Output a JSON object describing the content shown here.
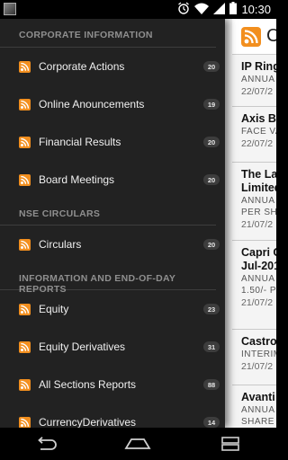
{
  "status_bar": {
    "time": "10:30",
    "icons": [
      "notification-image-icon",
      "alarm-icon",
      "wifi-icon",
      "signal-icon",
      "battery-icon"
    ]
  },
  "drawer": {
    "sections": [
      {
        "header": "CORPORATE INFORMATION",
        "items": [
          {
            "label": "Corporate Actions",
            "count": "20"
          },
          {
            "label": "Online Anouncements",
            "count": "19"
          },
          {
            "label": "Financial Results",
            "count": "20"
          },
          {
            "label": "Board Meetings",
            "count": "20"
          }
        ]
      },
      {
        "header": "NSE CIRCULARS",
        "items": [
          {
            "label": "Circulars",
            "count": "20"
          }
        ]
      },
      {
        "header": "INFORMATION AND END-OF-DAY REPORTS",
        "items": [
          {
            "label": "Equity",
            "count": "23"
          },
          {
            "label": "Equity Derivatives",
            "count": "31"
          },
          {
            "label": "All Sections Reports",
            "count": "88"
          },
          {
            "label": "CurrencyDerivatives",
            "count": "14"
          }
        ]
      }
    ]
  },
  "main": {
    "title": "C",
    "items": [
      {
        "title": "IP Ring",
        "lines": [
          "ANNUA"
        ],
        "date": "22/07/2"
      },
      {
        "title": "Axis Ba",
        "lines": [
          "FACE VA"
        ],
        "date": "22/07/2"
      },
      {
        "title": "The La",
        "title2": "Limited",
        "lines": [
          "ANNUA",
          "PER SH"
        ],
        "date": "21/07/2"
      },
      {
        "title": "Capri G",
        "title2": "Jul-201",
        "lines": [
          "ANNUA",
          "1.50/- P"
        ],
        "date": "21/07/2"
      },
      {
        "title": "Castro",
        "lines": [
          "INTERIM"
        ],
        "date": "21/07/2"
      },
      {
        "title": "Avanti",
        "lines": [
          "ANNUA",
          "SHARE"
        ],
        "date": ""
      }
    ]
  },
  "colors": {
    "drawer_bg": "#222222",
    "rss_orange": "#f28f1f",
    "badge_bg": "#3d3d3d",
    "section_header_text": "#8f8f8f"
  }
}
